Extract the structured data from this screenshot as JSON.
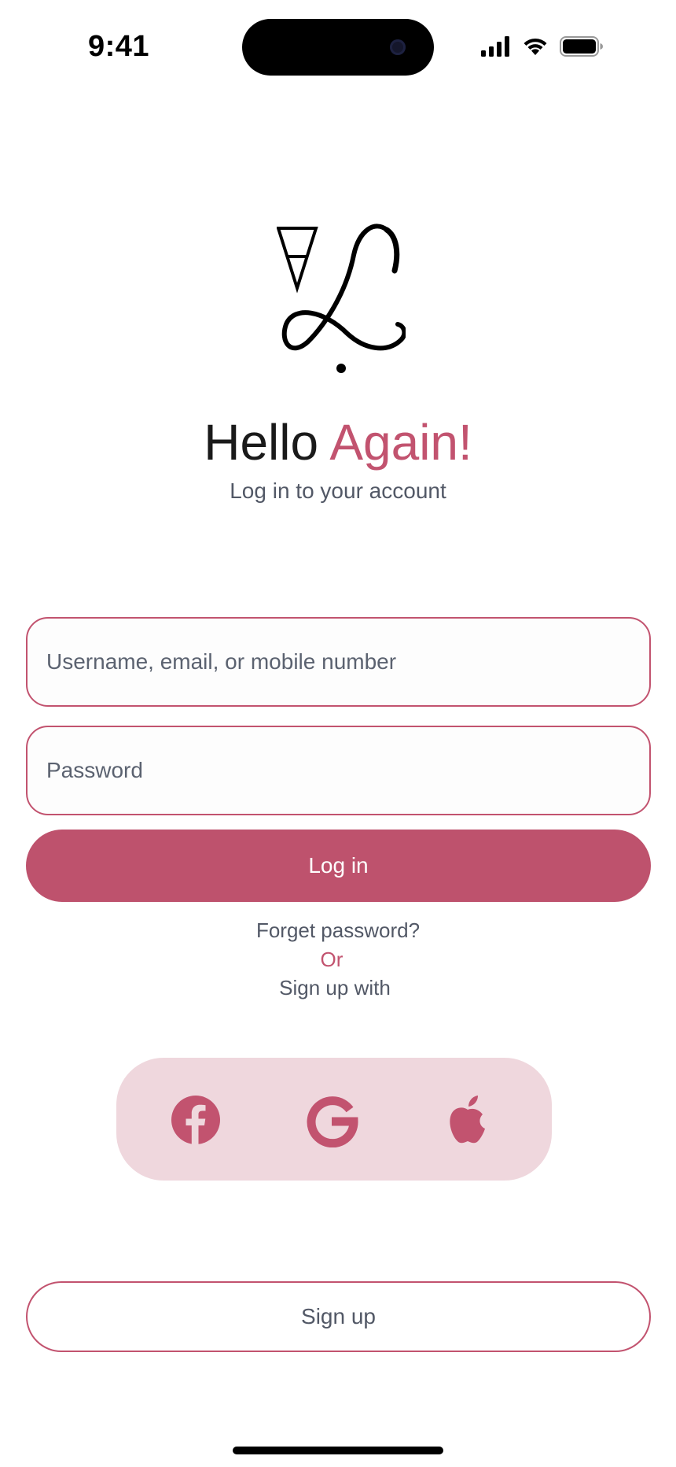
{
  "status_bar": {
    "time": "9:41",
    "icons": [
      "cellular-signal-icon",
      "wifi-icon",
      "battery-icon"
    ]
  },
  "logo": {
    "name": "brand-logo-monogram"
  },
  "greeting": {
    "hello": "Hello",
    "accent": "Again!",
    "subtitle": "Log in to your account"
  },
  "form": {
    "username_placeholder": "Username, email, or mobile number",
    "username_value": "",
    "password_placeholder": "Password",
    "password_value": "",
    "login_label": "Log in"
  },
  "links": {
    "forget": "Forget password?",
    "or": "Or",
    "signup_with": "Sign up with"
  },
  "social": [
    {
      "icon": "facebook-icon"
    },
    {
      "icon": "google-icon"
    },
    {
      "icon": "apple-icon"
    }
  ],
  "signup_label": "Sign up",
  "colors": {
    "accent": "#c2536f",
    "button": "#be526d",
    "social_bg": "#efd7dd"
  }
}
